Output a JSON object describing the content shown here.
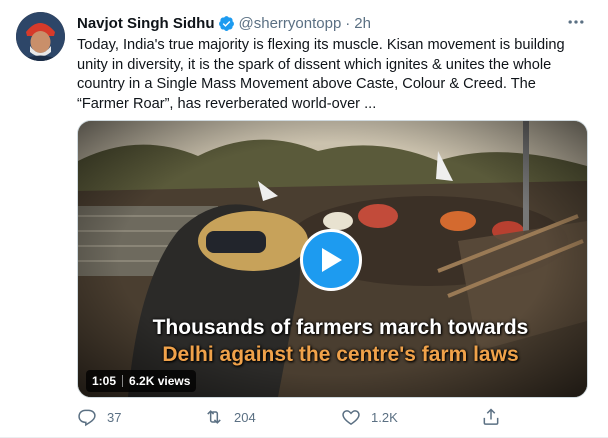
{
  "tweet": {
    "author_name": "Navjot Singh Sidhu",
    "handle": "@sherryontopp",
    "separator": "·",
    "time": "2h",
    "more_label": "···",
    "text_lines": [
      "Today, India's true majority is flexing its muscle. Kisan movement is building",
      "unity in diversity, it is the spark of dissent which ignites & unites the whole",
      "country in a Single Mass Movement above Caste, Colour & Creed. The",
      "“Farmer Roar”, has reverberated world-over ..."
    ]
  },
  "media": {
    "caption_line1": "Thousands of farmers march towards",
    "caption_line2": "Delhi against the centre's farm laws",
    "duration": "1:05",
    "views": "6.2K views"
  },
  "actions": {
    "reply_count": "37",
    "retweet_count": "204",
    "like_count": "1.2K"
  },
  "colors": {
    "accent": "#1d9bf0",
    "muted": "#5b7083",
    "caption_highlight": "#f0a24a"
  },
  "icons": [
    "verified-badge-icon",
    "more-icon",
    "play-icon",
    "reply-icon",
    "retweet-icon",
    "like-icon",
    "share-icon"
  ]
}
